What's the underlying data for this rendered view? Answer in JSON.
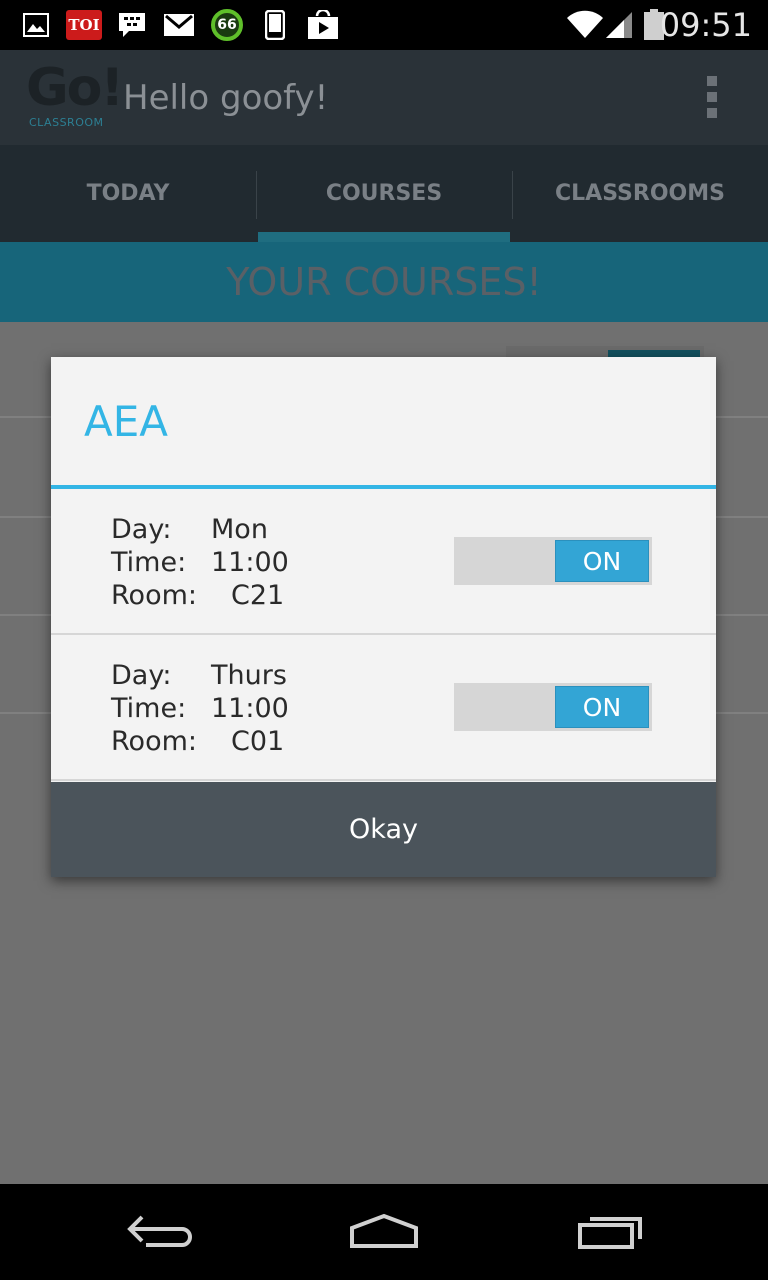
{
  "status_bar": {
    "time": "09:51",
    "notification_icons": [
      "gallery-icon",
      "toi-icon",
      "bbm-icon",
      "gmail-icon",
      "battery-saver-icon",
      "phone-icon",
      "play-store-icon"
    ],
    "toi_label": "TOI",
    "badge_66": "66"
  },
  "app_bar": {
    "logo_text": "Go!",
    "logo_sub": "CLASSROOM",
    "title": "Hello goofy!"
  },
  "tabs": [
    {
      "label": "TODAY",
      "active": false
    },
    {
      "label": "COURSES",
      "active": true
    },
    {
      "label": "CLASSROOMS",
      "active": false
    }
  ],
  "banner": {
    "text": "YOUR COURSES!"
  },
  "dialog": {
    "title": "AEA",
    "sessions": [
      {
        "day_label": "Day:",
        "day": "Mon",
        "time_label": "Time:",
        "time": "11:00",
        "room_label": "Room:",
        "room": "C21",
        "toggle": "ON"
      },
      {
        "day_label": "Day:",
        "day": "Thurs",
        "time_label": "Time:",
        "time": "11:00",
        "room_label": "Room:",
        "room": "C01",
        "toggle": "ON"
      }
    ],
    "button": "Okay"
  },
  "colors": {
    "accent": "#33b5e5",
    "app_bar": "#2a3238",
    "dialog_button": "#4b545b"
  }
}
